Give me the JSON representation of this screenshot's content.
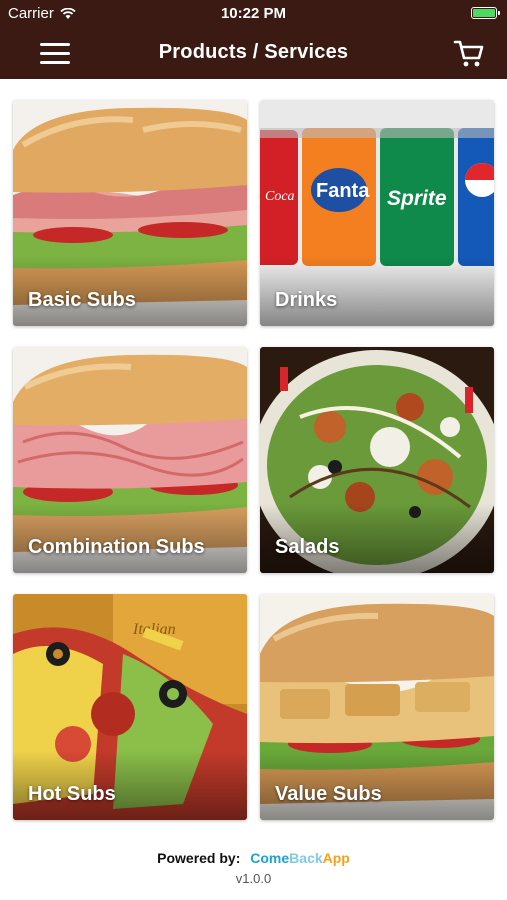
{
  "status_bar": {
    "carrier": "Carrier",
    "time": "10:22 PM"
  },
  "header": {
    "title": "Products / Services"
  },
  "categories": [
    {
      "label": "Basic Subs"
    },
    {
      "label": "Drinks"
    },
    {
      "label": "Combination Subs"
    },
    {
      "label": "Salads"
    },
    {
      "label": "Hot Subs"
    },
    {
      "label": "Value Subs"
    }
  ],
  "footer": {
    "powered_by": "Powered by:",
    "brand_come": "Come",
    "brand_back": "Back",
    "brand_app": "App",
    "version": "v1.0.0"
  },
  "colors": {
    "nav_bg": "#3a1a12",
    "brand_blue": "#1aa3d8",
    "brand_orange": "#f7a21b"
  },
  "icons": [
    "wifi-icon",
    "battery-icon",
    "hamburger-menu-icon",
    "cart-icon"
  ]
}
